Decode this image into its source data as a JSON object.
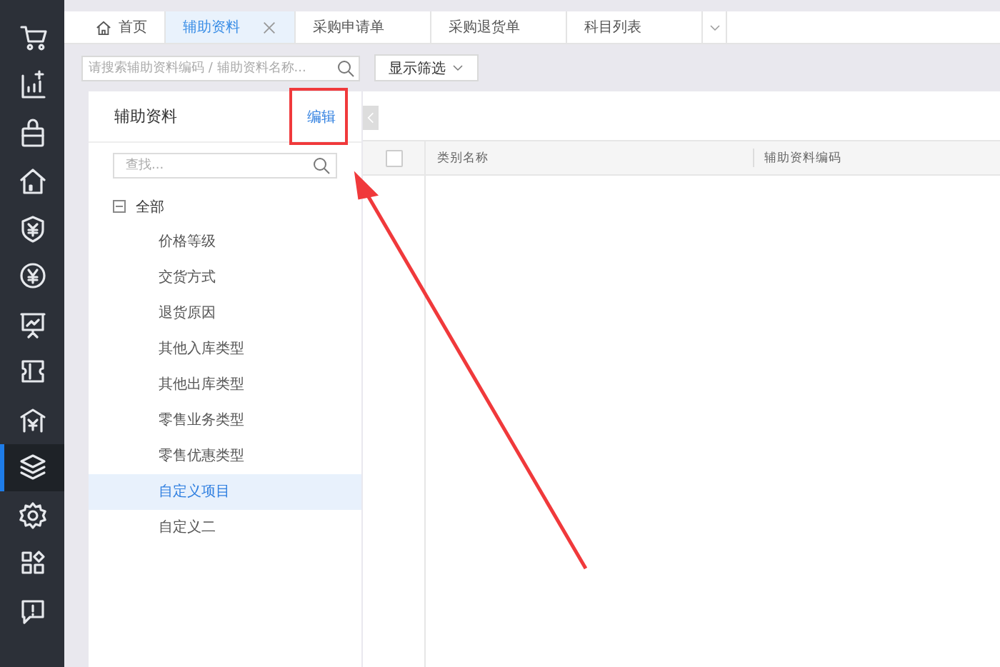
{
  "sidebar": {
    "items": [
      {
        "selected": false
      },
      {
        "selected": false
      },
      {
        "selected": false
      },
      {
        "selected": false
      },
      {
        "selected": false
      },
      {
        "selected": false
      },
      {
        "selected": false
      },
      {
        "selected": false
      },
      {
        "selected": false
      },
      {
        "selected": true
      },
      {
        "selected": false
      },
      {
        "selected": false
      },
      {
        "selected": false
      }
    ]
  },
  "tabs": [
    {
      "label": "首页",
      "selected": false,
      "kind": "home"
    },
    {
      "label": "辅助资料",
      "selected": true,
      "kind": "closable"
    },
    {
      "label": "采购申请单",
      "selected": false,
      "kind": "plain"
    },
    {
      "label": "采购退货单",
      "selected": false,
      "kind": "plain"
    },
    {
      "label": "科目列表",
      "selected": false,
      "kind": "plain"
    }
  ],
  "toolbar": {
    "search": {
      "placeholder": "请搜索辅助资料编码 / 辅助资料名称..."
    },
    "filter_button": "显示筛选"
  },
  "panel": {
    "title": "辅助资料",
    "edit_link": "编辑",
    "search": {
      "placeholder": "查找..."
    },
    "tree": [
      {
        "label": "全部",
        "expanded": true,
        "selected": false,
        "children": [
          {
            "label": "价格等级",
            "selected": false
          },
          {
            "label": "交货方式",
            "selected": false
          },
          {
            "label": "退货原因",
            "selected": false
          },
          {
            "label": "其他入库类型",
            "selected": false
          },
          {
            "label": "其他出库类型",
            "selected": false
          },
          {
            "label": "零售业务类型",
            "selected": false
          },
          {
            "label": "零售优惠类型",
            "selected": false
          },
          {
            "label": "自定义项目",
            "selected": true
          },
          {
            "label": "自定义二",
            "selected": false
          }
        ]
      }
    ]
  },
  "table": {
    "select_all_checked": false,
    "columns": [
      "类别名称",
      "辅助资料编码"
    ]
  }
}
